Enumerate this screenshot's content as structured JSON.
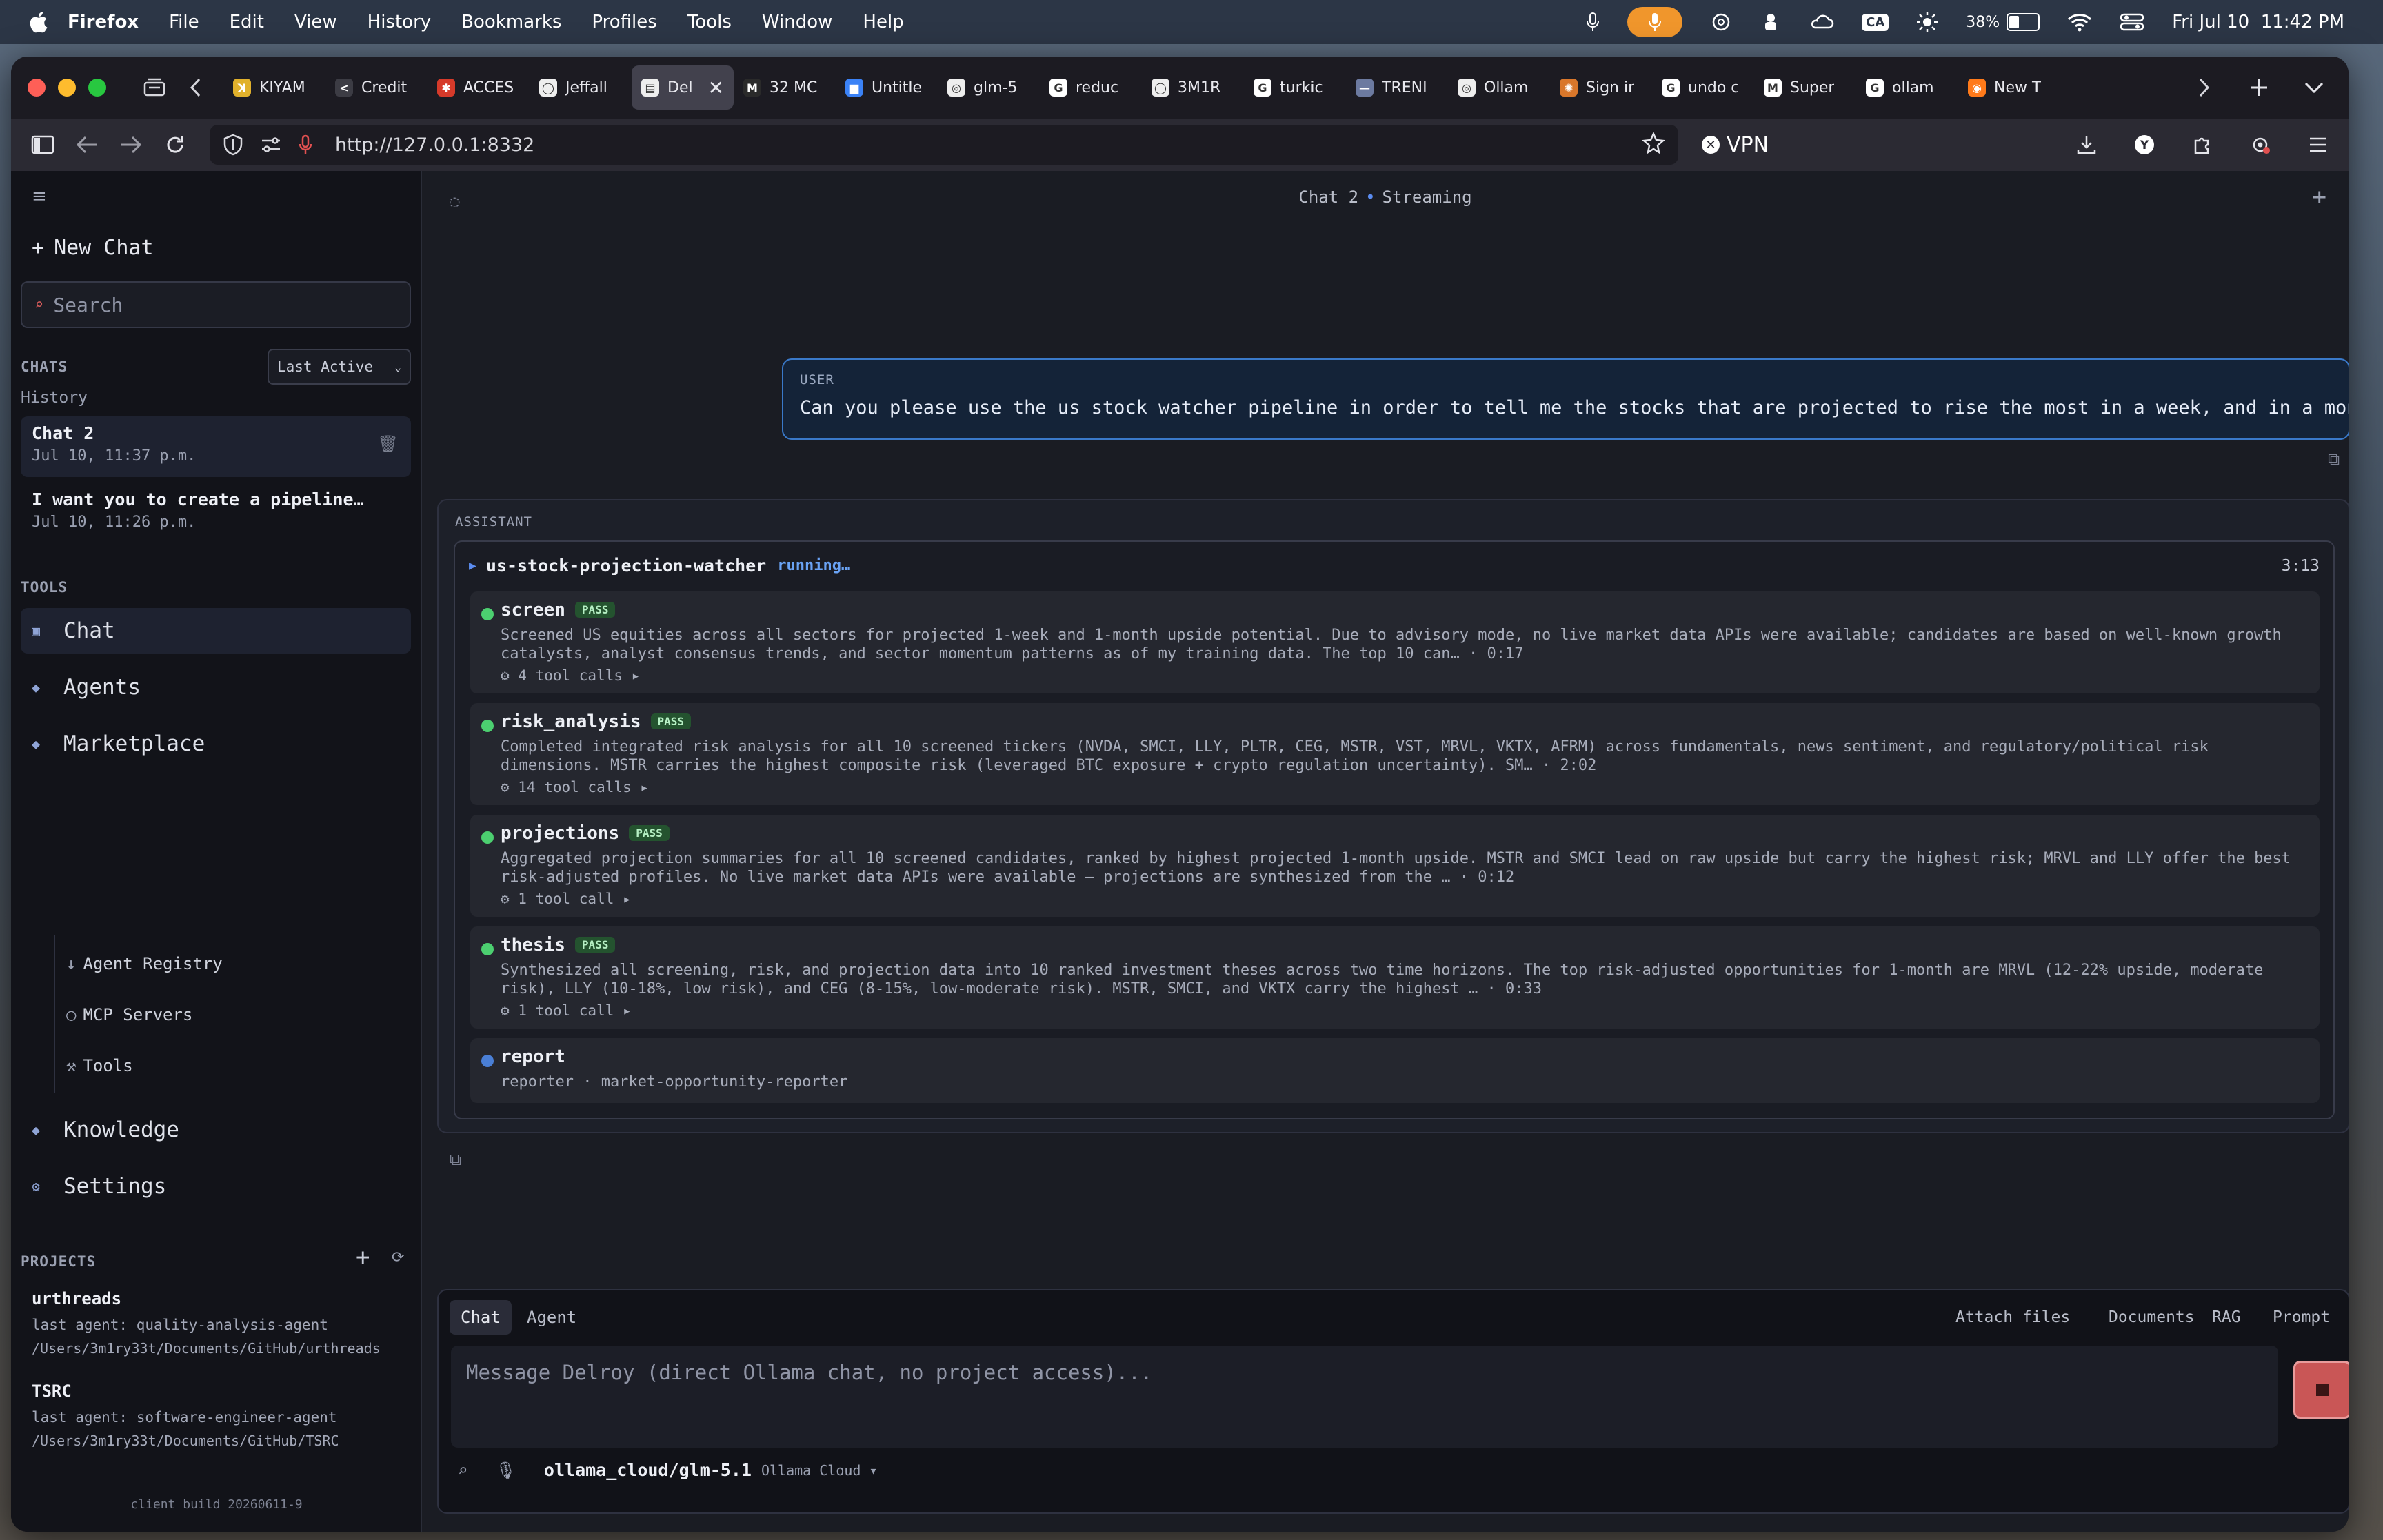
{
  "os_menubar": {
    "app_name": "Firefox",
    "menus": [
      "File",
      "Edit",
      "View",
      "History",
      "Bookmarks",
      "Profiles",
      "Tools",
      "Window",
      "Help"
    ],
    "status_badge": "CA",
    "battery_text": "38%",
    "battery_level": 0.38,
    "datetime": "Fri Jul 10  11:42 PM"
  },
  "browser": {
    "tabs": [
      {
        "label": "KIYAM",
        "fav_color": "#e1b12c",
        "fav_char": "ꓘ",
        "active": false
      },
      {
        "label": "Credit",
        "fav_color": "#3c3c44",
        "fav_char": "<",
        "active": false
      },
      {
        "label": "ACCES",
        "fav_color": "#d63a2a",
        "fav_char": "✱",
        "active": false
      },
      {
        "label": "Jeffall",
        "fav_color": "#eeeeee",
        "fav_char": "◯",
        "active": false
      },
      {
        "label": "Del",
        "fav_color": "#eeeeee",
        "fav_char": "▤",
        "active": true
      },
      {
        "label": "32 MC",
        "fav_color": "#2a2a2a",
        "fav_char": "M",
        "active": false
      },
      {
        "label": "Untitle",
        "fav_color": "#3b82f6",
        "fav_char": "▆",
        "active": false
      },
      {
        "label": "glm-5",
        "fav_color": "#eeeeee",
        "fav_char": "◎",
        "active": false
      },
      {
        "label": "reduc",
        "fav_color": "#ffffff",
        "fav_char": "G",
        "active": false
      },
      {
        "label": "3M1R",
        "fav_color": "#eeeeee",
        "fav_char": "◯",
        "active": false
      },
      {
        "label": "turkic",
        "fav_color": "#ffffff",
        "fav_char": "G",
        "active": false
      },
      {
        "label": "TRENI",
        "fav_color": "#6c7aa0",
        "fav_char": "—",
        "active": false
      },
      {
        "label": "Ollam",
        "fav_color": "#eeeeee",
        "fav_char": "◎",
        "active": false
      },
      {
        "label": "Sign ir",
        "fav_color": "#d9772b",
        "fav_char": "✺",
        "active": false
      },
      {
        "label": "undo c",
        "fav_color": "#ffffff",
        "fav_char": "G",
        "active": false
      },
      {
        "label": "Super",
        "fav_color": "#ffffff",
        "fav_char": "M",
        "active": false
      },
      {
        "label": "ollam",
        "fav_color": "#ffffff",
        "fav_char": "G",
        "active": false
      },
      {
        "label": "New T",
        "fav_color": "#ff7a1a",
        "fav_char": "◉",
        "active": false
      }
    ],
    "url": "http://127.0.0.1:8332",
    "vpn_label": "VPN"
  },
  "sidebar": {
    "new_chat_label": "New Chat",
    "search_placeholder": "Search",
    "chats_heading": "CHATS",
    "sort_value": "Last Active",
    "history_label": "History",
    "chats": [
      {
        "title": "Chat 2",
        "date": "Jul 10, 11:37 p.m.",
        "active": true
      },
      {
        "title": "I want you to create a pipeline…",
        "date": "Jul 10, 11:26 p.m.",
        "active": false
      }
    ],
    "tools_heading": "TOOLS",
    "nav": [
      {
        "label": "Chat",
        "icon": "▣"
      },
      {
        "label": "Agents",
        "icon": "◆"
      },
      {
        "label": "Marketplace",
        "icon": "◆"
      }
    ],
    "marketplace_sub": [
      {
        "label": "Agent Registry",
        "icon": "↓"
      },
      {
        "label": "MCP Servers",
        "icon": "○"
      },
      {
        "label": "Tools",
        "icon": "⚒"
      }
    ],
    "nav2": [
      {
        "label": "Knowledge",
        "icon": "◆"
      },
      {
        "label": "Settings",
        "icon": "⚙"
      }
    ],
    "projects_heading": "PROJECTS",
    "projects": [
      {
        "name": "urthreads",
        "last_agent": "last agent: quality-analysis-agent",
        "path": "/Users/3m1ry33t/Documents/GitHub/urthreads"
      },
      {
        "name": "TSRC",
        "last_agent": "last agent: software-engineer-agent",
        "path": "/Users/3m1ry33t/Documents/GitHub/TSRC"
      }
    ],
    "build": "client build 20260611-9"
  },
  "main": {
    "title_chat": "Chat 2",
    "title_sep": "•",
    "title_status": "Streaming",
    "user_role": "USER",
    "user_message": "Can you please use the us stock watcher pipeline in order to tell me the stocks that are projected to rise the most in a week, and in a month?",
    "assistant_role": "ASSISTANT",
    "pipeline": {
      "name": "us-stock-projection-watcher",
      "status": "running…",
      "elapsed": "3:13",
      "steps": [
        {
          "name": "screen",
          "badge": "PASS",
          "dot_color": "#4ccf70",
          "desc": "Screened US equities across all sectors for projected 1-week and 1-month upside potential. Due to advisory mode, no live market data APIs were available; candidates are based on well-known growth catalysts, analyst consensus trends, and sector momentum patterns as of my training data. The top 10 can… · 0:17",
          "tools": "⚙ 4 tool calls ▸"
        },
        {
          "name": "risk_analysis",
          "badge": "PASS",
          "dot_color": "#4ccf70",
          "desc": "Completed integrated risk analysis for all 10 screened tickers (NVDA, SMCI, LLY, PLTR, CEG, MSTR, VST, MRVL, VKTX, AFRM) across fundamentals, news sentiment, and regulatory/political risk dimensions. MSTR carries the highest composite risk (leveraged BTC exposure + crypto regulation uncertainty). SM… · 2:02",
          "tools": "⚙ 14 tool calls ▸"
        },
        {
          "name": "projections",
          "badge": "PASS",
          "dot_color": "#4ccf70",
          "desc": "Aggregated projection summaries for all 10 screened candidates, ranked by highest projected 1-month upside. MSTR and SMCI lead on raw upside but carry the highest risk; MRVL and LLY offer the best risk-adjusted profiles. No live market data APIs were available — projections are synthesized from the … · 0:12",
          "tools": "⚙ 1 tool call ▸"
        },
        {
          "name": "thesis",
          "badge": "PASS",
          "dot_color": "#4ccf70",
          "desc": "Synthesized all screening, risk, and projection data into 10 ranked investment theses across two time horizons. The top risk-adjusted opportunities for 1-month are MRVL (12-22% upside, moderate risk), LLY (10-18%, low risk), and CEG (8-15%, low-moderate risk). MSTR, SMCI, and VKTX carry the highest … · 0:33",
          "tools": "⚙ 1 tool call ▸"
        },
        {
          "name": "report",
          "badge": "",
          "dot_color": "#4a7fd6",
          "desc": "reporter · market-opportunity-reporter",
          "tools": ""
        }
      ]
    }
  },
  "composer": {
    "tab_chat": "Chat",
    "tab_agent": "Agent",
    "attach_label": "Attach files",
    "documents_label": "Documents",
    "rag_label": "RAG",
    "prompt_label": "Prompt",
    "placeholder": "Message Delroy (direct Ollama chat, no project access)...",
    "model": "ollama_cloud/glm-5.1",
    "provider": "Ollama Cloud ▾"
  }
}
